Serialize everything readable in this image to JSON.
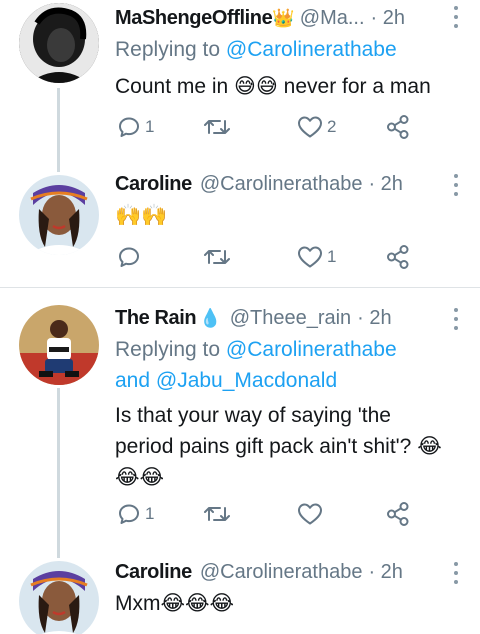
{
  "tweets": [
    {
      "name": "MaShengeOffline",
      "name_emoji": "👑",
      "handle": "@Ma...",
      "time": "· 2h",
      "replying_prefix": "Replying to ",
      "replying_to": "@Carolinerathabe",
      "text": "Count me in 😅😅 never for a man",
      "reply_count": "1",
      "retweet_count": "",
      "like_count": "2"
    },
    {
      "name": "Caroline",
      "handle": "@Carolinerathabe",
      "time": "· 2h",
      "text": "🙌🙌",
      "reply_count": "",
      "retweet_count": "",
      "like_count": "1"
    },
    {
      "name": "The Rain",
      "name_emoji": "💧",
      "handle": "@Theee_rain",
      "time": "· 2h",
      "replying_prefix": "Replying to ",
      "replying_to": "@Carolinerathabe",
      "replying_and": "and ",
      "replying_to_2": "@Jabu_Macdonald",
      "text_line1": "Is that your way of saying 'the",
      "text_line2": "period pains gift pack ain't shit'? 😂",
      "text_line3": "😂😂",
      "reply_count": "1",
      "retweet_count": "",
      "like_count": ""
    },
    {
      "name": "Caroline",
      "handle": "@Carolinerathabe",
      "time": "· 2h",
      "text": "Mxm😂😂😂"
    }
  ],
  "colors": {
    "link": "#1da1f2",
    "muted": "#657786",
    "thread_line": "#cfd9de"
  },
  "icons": [
    "reply-icon",
    "retweet-icon",
    "like-icon",
    "share-icon",
    "more-icon"
  ]
}
